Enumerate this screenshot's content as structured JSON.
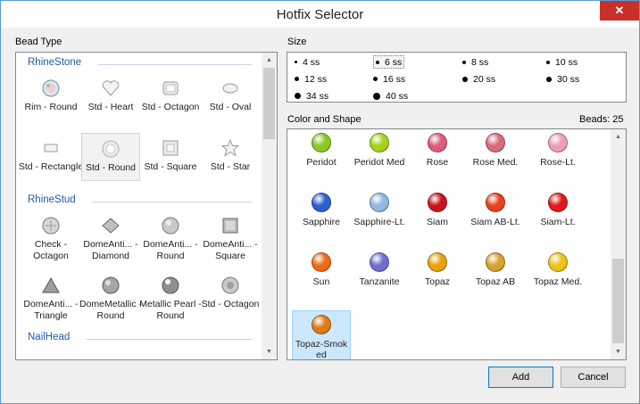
{
  "window": {
    "title": "Hotfix Selector",
    "close_glyph": "✕"
  },
  "bead_type": {
    "label": "Bead Type",
    "groups": [
      {
        "name": "RhineStone",
        "items": [
          {
            "label": "Rim - Round",
            "icon": "rim-round-icon"
          },
          {
            "label": "Std - Heart",
            "icon": "heart-icon"
          },
          {
            "label": "Std - Octagon",
            "icon": "octagon-icon"
          },
          {
            "label": "Std - Oval",
            "icon": "oval-icon"
          },
          {
            "label": "Std - Rectangle",
            "icon": "rectangle-icon"
          },
          {
            "label": "Std - Round",
            "icon": "round-icon",
            "selected": true
          },
          {
            "label": "Std - Square",
            "icon": "square-icon"
          },
          {
            "label": "Std - Star",
            "icon": "star-icon"
          }
        ]
      },
      {
        "name": "RhineStud",
        "items": [
          {
            "label": "Check - Octagon",
            "icon": "check-octagon-icon"
          },
          {
            "label": "DomeAnti... - Diamond",
            "icon": "diamond-icon"
          },
          {
            "label": "DomeAnti... - Round",
            "icon": "dome-round-icon"
          },
          {
            "label": "DomeAnti... - Square",
            "icon": "dome-square-icon"
          },
          {
            "label": "DomeAnti... - Triangle",
            "icon": "triangle-icon"
          },
          {
            "label": "DomeMetallic - Round",
            "icon": "metallic-round-icon"
          },
          {
            "label": "Metallic Pearl - Round",
            "icon": "pearl-icon"
          },
          {
            "label": "Std - Octagon",
            "icon": "stud-octagon-icon"
          }
        ]
      },
      {
        "name": "NailHead",
        "items": []
      }
    ]
  },
  "size": {
    "label": "Size",
    "options": [
      {
        "label": "4 ss"
      },
      {
        "label": "6 ss",
        "selected": true
      },
      {
        "label": "8 ss"
      },
      {
        "label": "10 ss"
      },
      {
        "label": "12 ss"
      },
      {
        "label": "16 ss"
      },
      {
        "label": "20 ss"
      },
      {
        "label": "30 ss"
      },
      {
        "label": "34 ss"
      },
      {
        "label": "40 ss"
      }
    ]
  },
  "color_shape": {
    "label": "Color and Shape",
    "beads_count_label": "Beads: 25",
    "items": [
      {
        "label": "Peridot",
        "color": "#8ac926"
      },
      {
        "label": "Peridot Med",
        "color": "#a4d21c"
      },
      {
        "label": "Rose",
        "color": "#e05a7a"
      },
      {
        "label": "Rose Med.",
        "color": "#d96a7e"
      },
      {
        "label": "Rose-Lt.",
        "color": "#ef9db2"
      },
      {
        "label": "Sapphire",
        "color": "#2d5fd1"
      },
      {
        "label": "Sapphire-Lt.",
        "color": "#8fb8e3"
      },
      {
        "label": "Siam",
        "color": "#c8141e"
      },
      {
        "label": "Siam AB-Lt.",
        "color": "#e8401c"
      },
      {
        "label": "Siam-Lt.",
        "color": "#e3181c"
      },
      {
        "label": "Sun",
        "color": "#f06a14"
      },
      {
        "label": "Tanzanite",
        "color": "#6f6fcf"
      },
      {
        "label": "Topaz",
        "color": "#e8a20e"
      },
      {
        "label": "Topaz AB",
        "color": "#d8a030"
      },
      {
        "label": "Topaz Med.",
        "color": "#f1c21a"
      },
      {
        "label": "Topaz-Smoked",
        "color": "#e07a18",
        "selected": true
      }
    ]
  },
  "buttons": {
    "add": "Add",
    "cancel": "Cancel"
  }
}
